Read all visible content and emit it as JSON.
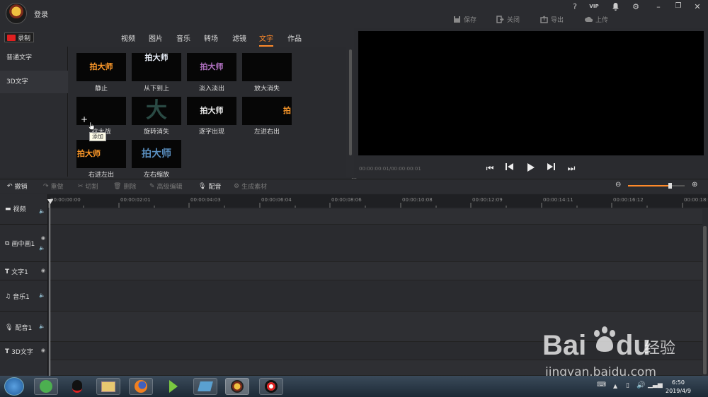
{
  "header": {
    "login": "登录",
    "window_controls": [
      "?",
      "VIP",
      "bell",
      "gear",
      "minimize",
      "maximize",
      "close"
    ],
    "actions": [
      {
        "icon": "save-icon",
        "label": "保存"
      },
      {
        "icon": "exit-icon",
        "label": "关闭"
      },
      {
        "icon": "export-icon",
        "label": "导出"
      },
      {
        "icon": "upload-icon",
        "label": "上传"
      }
    ]
  },
  "record_button": "录制",
  "media_tabs": [
    {
      "label": "视频",
      "active": false
    },
    {
      "label": "图片",
      "active": false
    },
    {
      "label": "音乐",
      "active": false
    },
    {
      "label": "转场",
      "active": false
    },
    {
      "label": "滤镜",
      "active": false
    },
    {
      "label": "文字",
      "active": true
    },
    {
      "label": "作品",
      "active": false
    }
  ],
  "categories": [
    {
      "label": "普通文字",
      "selected": false
    },
    {
      "label": "3D文字",
      "selected": true
    }
  ],
  "effects": [
    {
      "label": "静止",
      "preview": "拍大师"
    },
    {
      "label": "从下到上",
      "preview": "拍大师"
    },
    {
      "label": "淡入淡出",
      "preview": "拍大师"
    },
    {
      "label": "放大消失",
      "preview": ""
    },
    {
      "label": "拉大战",
      "preview": ""
    },
    {
      "label": "旋转消失",
      "preview": "大"
    },
    {
      "label": "逐字出现",
      "preview": "拍大师"
    },
    {
      "label": "左进右出",
      "preview": "拍"
    },
    {
      "label": "右进左出",
      "preview": "拍大师"
    },
    {
      "label": "左右缩放",
      "preview": "拍大师"
    }
  ],
  "tooltip_add": "添加",
  "timecode": "00:00:00:01/00:00:00:01",
  "toolbar": [
    {
      "icon": "undo-icon",
      "label": "撤销",
      "enabled": true
    },
    {
      "icon": "redo-icon",
      "label": "重做",
      "enabled": false
    },
    {
      "icon": "cut-icon",
      "label": "切割",
      "enabled": false
    },
    {
      "icon": "delete-icon",
      "label": "删除",
      "enabled": false
    },
    {
      "icon": "edit-icon",
      "label": "高级编辑",
      "enabled": false
    },
    {
      "icon": "mic-icon",
      "label": "配音",
      "enabled": true
    },
    {
      "icon": "generate-icon",
      "label": "生成素材",
      "enabled": false
    }
  ],
  "zoom_level": 0.75,
  "ruler_ticks": [
    "00:00:00:00",
    "00:00:02:01",
    "00:00:04:03",
    "00:00:06:04",
    "00:00:08:06",
    "00:00:10:08",
    "00:00:12:09",
    "00:00:14:11",
    "00:00:16:12",
    "00:00:18:1"
  ],
  "tracks": [
    {
      "label": "视频",
      "icon": "video-track-icon"
    },
    {
      "label": "画中画1",
      "icon": "pip-track-icon"
    },
    {
      "label": "文字1",
      "icon": "text-track-icon"
    },
    {
      "label": "音乐1",
      "icon": "music-track-icon"
    },
    {
      "label": "配音1",
      "icon": "mic-track-icon"
    },
    {
      "label": "3D文字",
      "icon": "text3d-track-icon"
    }
  ],
  "taskbar": {
    "time": "6:50",
    "date": "2019/4/9"
  },
  "watermark": {
    "brand": "Bai",
    "brand2": "du",
    "cn": "经验",
    "url": "jingyan.baidu.com"
  },
  "colors": {
    "accent": "#ff8a2a",
    "record": "#e02020"
  }
}
